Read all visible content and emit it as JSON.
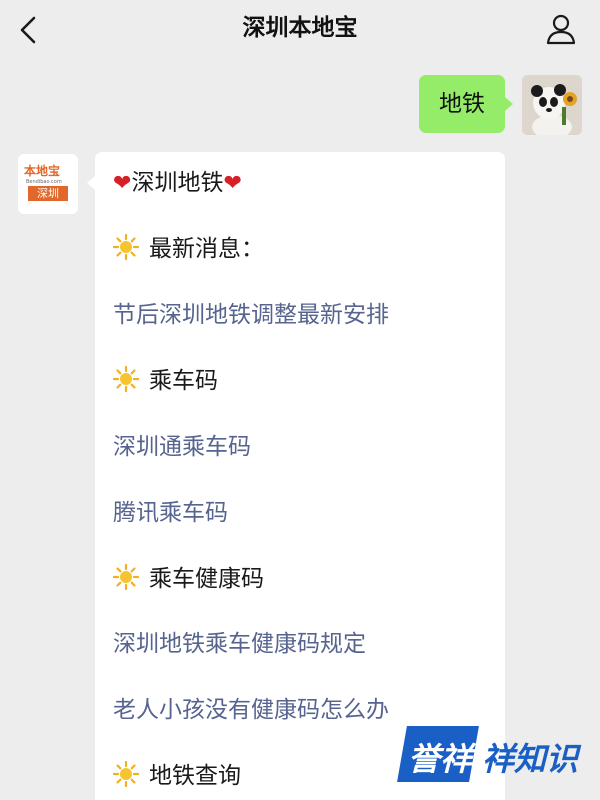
{
  "header": {
    "title": "深圳本地宝"
  },
  "outgoing": {
    "text": "地铁"
  },
  "bot_logo": {
    "top": "本地宝",
    "url": "Bendibao.com",
    "badge": "深圳"
  },
  "incoming": {
    "title": "深圳地铁",
    "heart": "❤",
    "sections": [
      {
        "heading": "最新消息：",
        "links": [
          "节后深圳地铁调整最新安排"
        ]
      },
      {
        "heading": "乘车码",
        "links": [
          "深圳通乘车码",
          "腾讯乘车码"
        ]
      },
      {
        "heading": "乘车健康码",
        "links": [
          "深圳地铁乘车健康码规定",
          "老人小孩没有健康码怎么办"
        ]
      },
      {
        "heading": "地铁查询",
        "links": []
      }
    ]
  },
  "watermark": {
    "boxed": "誉祥",
    "rest": "祥知识"
  },
  "colors": {
    "background": "#ededed",
    "outgoing_bubble": "#95ec69",
    "link": "#56648f",
    "heart": "#d71f26",
    "brand_orange": "#e1672a",
    "watermark_blue": "#1a5fc6"
  },
  "icons": {
    "back": "chevron-left-icon",
    "profile": "person-icon",
    "sun": "sun-icon"
  }
}
